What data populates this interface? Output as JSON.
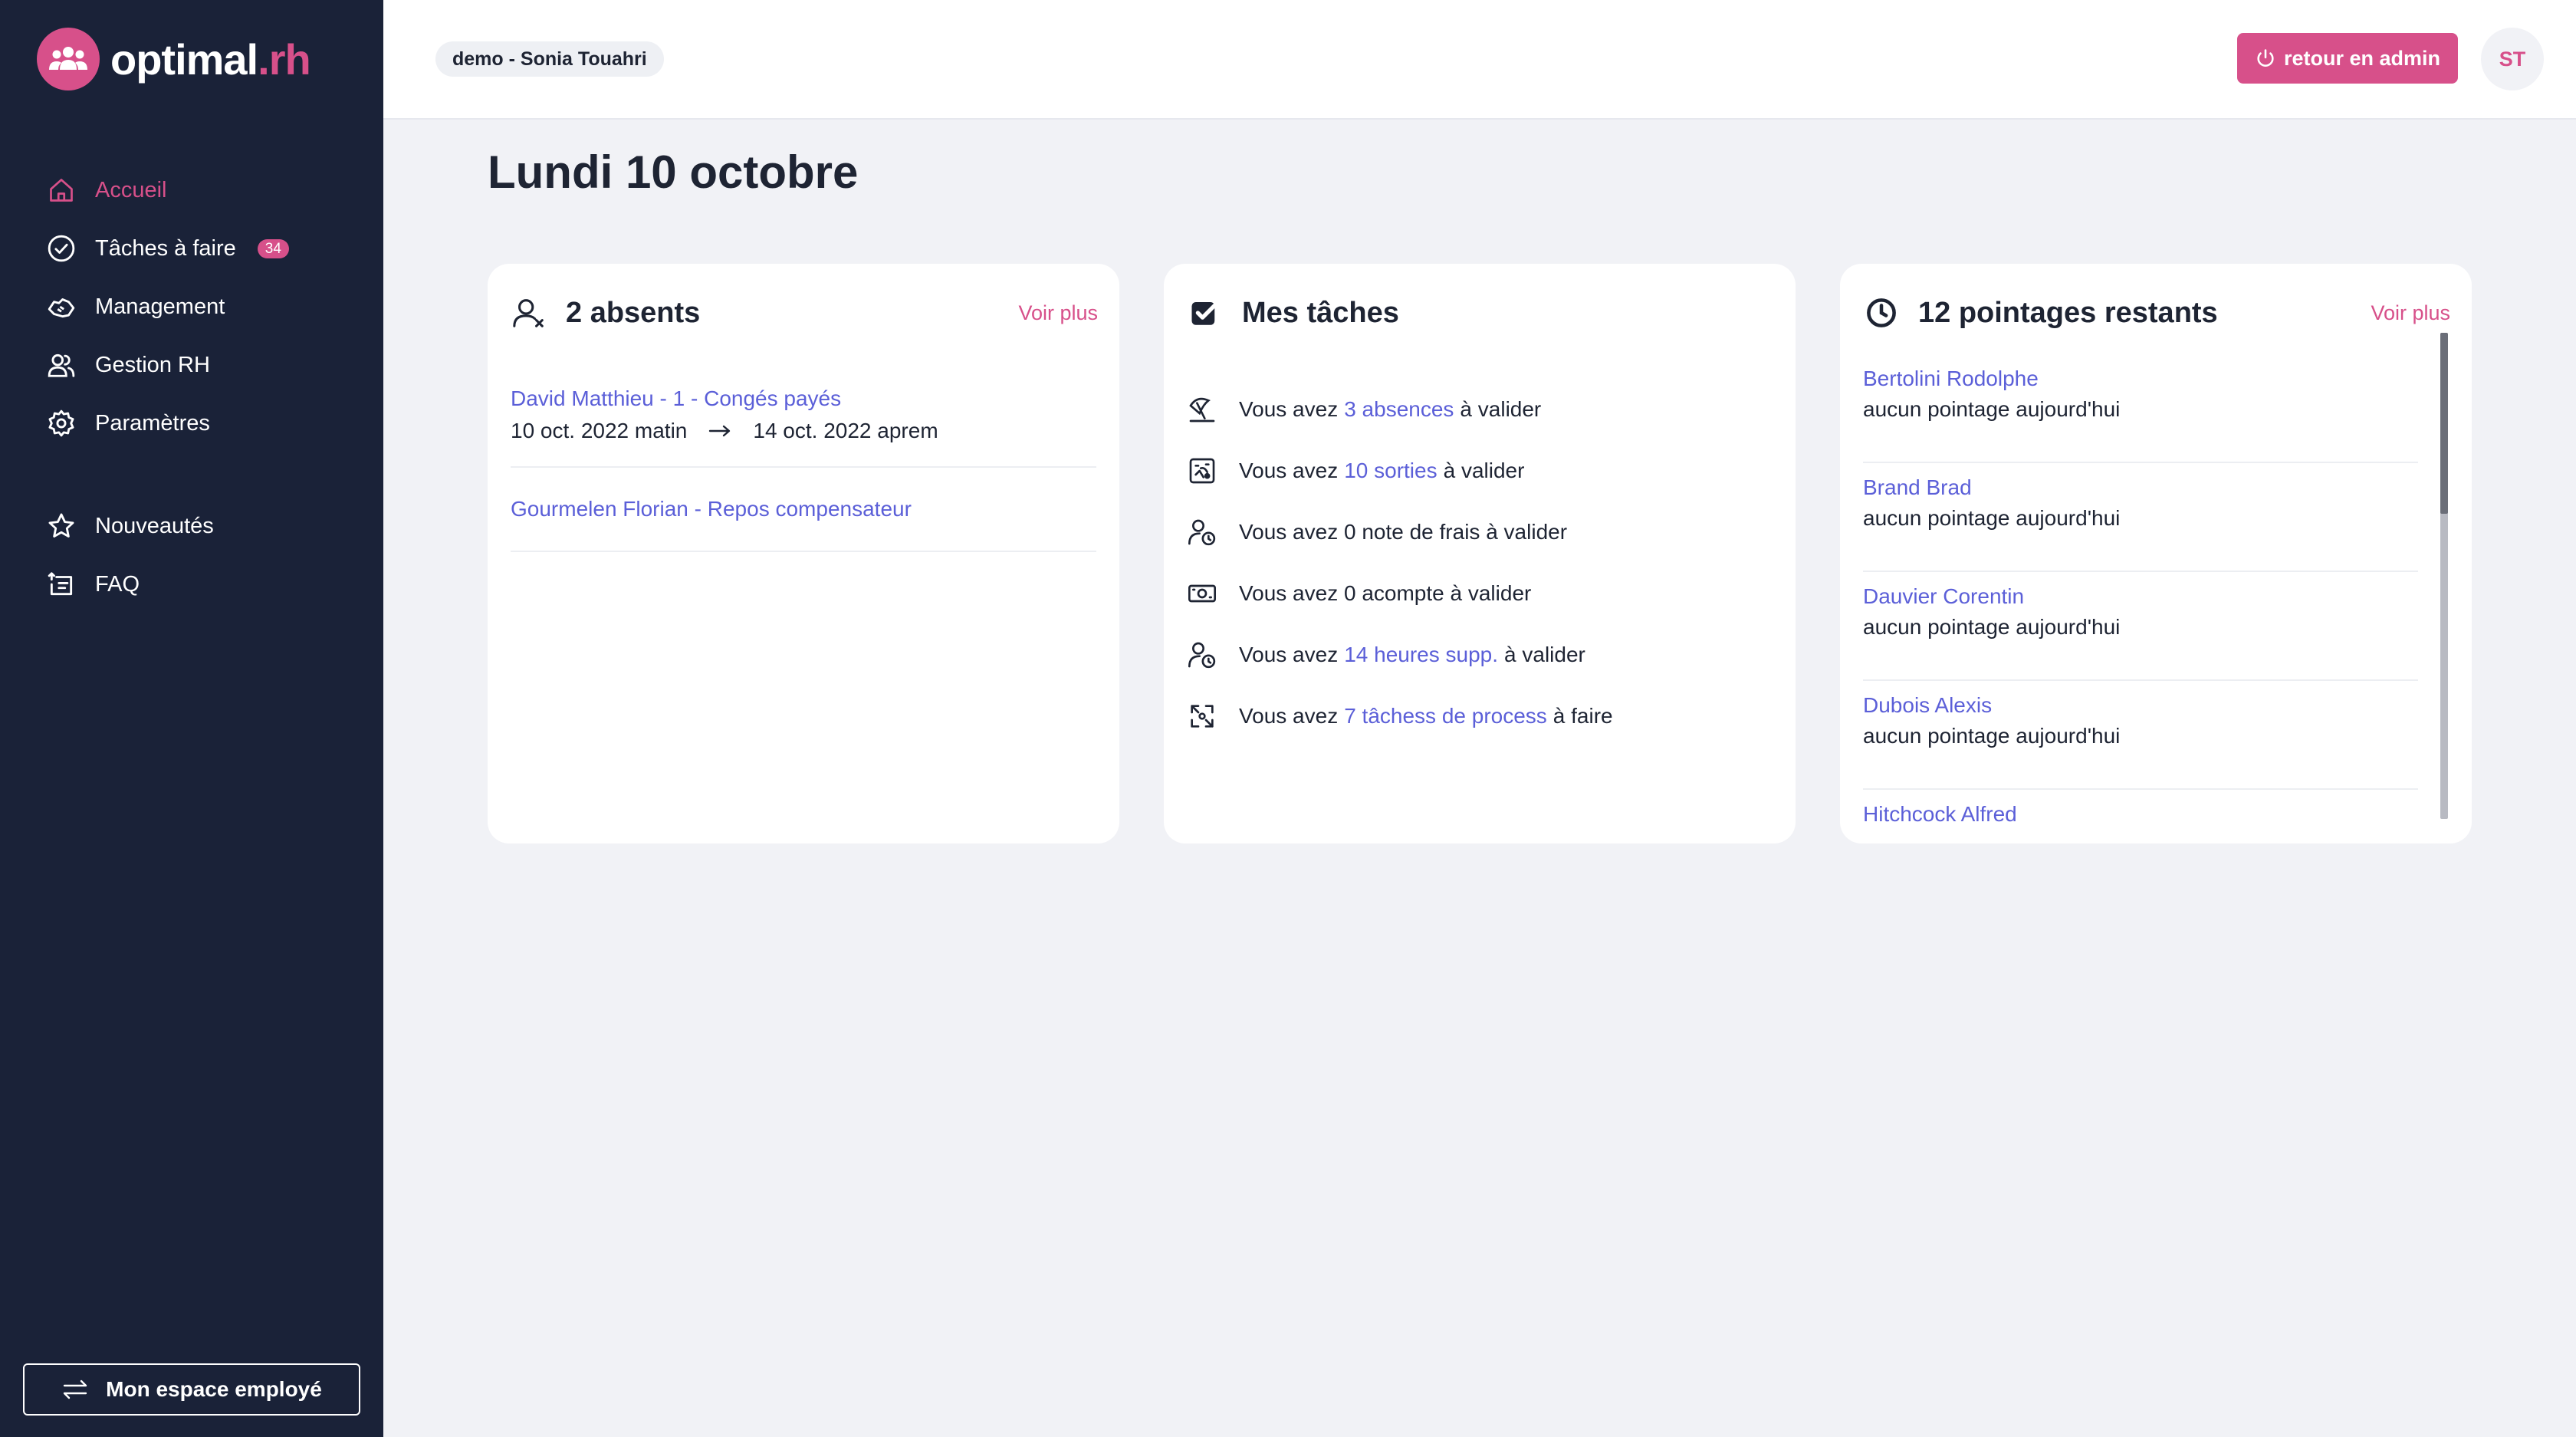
{
  "app": {
    "logo_name": "optimal",
    "logo_dot": ".",
    "logo_suffix": "rh"
  },
  "sidebar": {
    "items": [
      {
        "label": "Accueil",
        "icon": "home-icon",
        "active": true
      },
      {
        "label": "Tâches à faire",
        "icon": "check-circle-icon",
        "badge": "34"
      },
      {
        "label": "Management",
        "icon": "handshake-icon"
      },
      {
        "label": "Gestion RH",
        "icon": "users-icon"
      },
      {
        "label": "Paramètres",
        "icon": "gear-icon"
      }
    ],
    "secondary": [
      {
        "label": "Nouveautés",
        "icon": "star-icon"
      },
      {
        "label": "FAQ",
        "icon": "faq-icon"
      }
    ],
    "employee_button": "Mon espace employé"
  },
  "header": {
    "demo_label": "demo - Sonia Touahri",
    "admin_button": "retour en admin",
    "avatar_initials": "ST"
  },
  "main": {
    "title": "Lundi 10 octobre",
    "absents": {
      "title": "2 absents",
      "voir_plus": "Voir plus",
      "items": [
        {
          "name": "David Matthieu - 1 - Congés payés",
          "from": "10 oct. 2022 matin",
          "to": "14 oct. 2022 aprem"
        },
        {
          "name": "Gourmelen Florian - Repos compensateur"
        }
      ]
    },
    "tasks": {
      "title": "Mes tâches",
      "items": [
        {
          "prefix": "Vous avez",
          "link": "3 absences",
          "suffix": "à valider",
          "icon": "beach-umbrella-icon"
        },
        {
          "prefix": "Vous avez",
          "link": "10 sorties",
          "suffix": "à valider",
          "icon": "map-icon"
        },
        {
          "prefix": "Vous avez 0 note de frais à valider",
          "link": "",
          "suffix": "",
          "icon": "user-clock-icon"
        },
        {
          "prefix": "Vous avez 0 acompte à valider",
          "link": "",
          "suffix": "",
          "icon": "money-icon"
        },
        {
          "prefix": "Vous avez",
          "link": "14 heures supp.",
          "suffix": "à valider",
          "icon": "user-clock-icon"
        },
        {
          "prefix": "Vous avez",
          "link": "7 tâchess de process",
          "suffix": "à faire",
          "icon": "process-icon"
        }
      ]
    },
    "pointages": {
      "title": "12 pointages restants",
      "voir_plus": "Voir plus",
      "items": [
        {
          "name": "Bertolini Rodolphe",
          "status": "aucun pointage aujourd'hui"
        },
        {
          "name": "Brand Brad",
          "status": "aucun pointage aujourd'hui"
        },
        {
          "name": "Dauvier Corentin",
          "status": "aucun pointage aujourd'hui"
        },
        {
          "name": "Dubois Alexis",
          "status": "aucun pointage aujourd'hui"
        },
        {
          "name": "Hitchcock Alfred",
          "status": ""
        }
      ]
    }
  },
  "colors": {
    "sidebar_bg": "#1a2238",
    "accent": "#d7508a",
    "link": "#5b5fd8",
    "page_bg": "#f1f2f6"
  }
}
